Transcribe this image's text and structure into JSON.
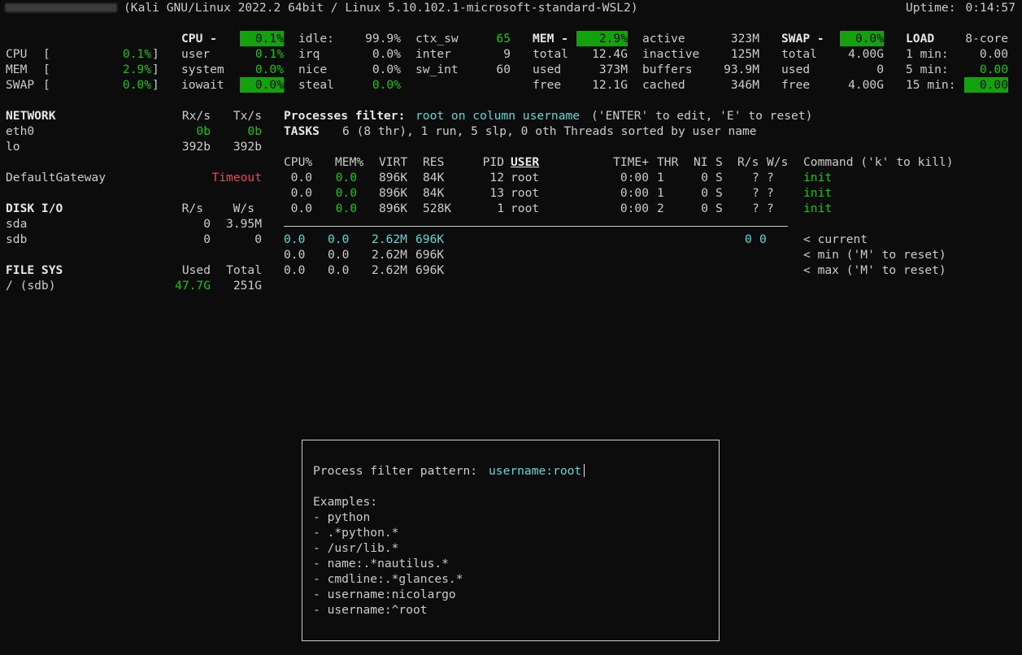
{
  "header": {
    "title": "(Kali GNU/Linux 2022.2 64bit / Linux 5.10.102.1-microsoft-standard-WSL2)",
    "uptime_label": "Uptime:",
    "uptime_value": "0:14:57"
  },
  "quicklook": {
    "cpu_label": "CPU",
    "cpu_value": "0.1%",
    "mem_label": "MEM",
    "mem_value": "2.9%",
    "swap_label": "SWAP",
    "swap_value": "0.0%",
    "open_bracket": "[",
    "close_bracket": "]"
  },
  "cpu": {
    "header": "CPU -",
    "total": "0.1%",
    "user_label": "user",
    "user": "0.1%",
    "system_label": "system",
    "system": "0.0%",
    "iowait_label": "iowait",
    "iowait": "0.0%",
    "idle_label": "idle:",
    "idle": "99.9%",
    "irq_label": "irq",
    "irq": "0.0%",
    "nice_label": "nice",
    "nice": "0.0%",
    "steal_label": "steal",
    "steal": "0.0%",
    "ctx_sw_label": "ctx_sw",
    "ctx_sw": "65",
    "inter_label": "inter",
    "inter": "9",
    "sw_int_label": "sw_int",
    "sw_int": "60"
  },
  "mem": {
    "header": "MEM -",
    "percent": "2.9%",
    "total_label": "total",
    "total": "12.4G",
    "used_label": "used",
    "used": "373M",
    "free_label": "free",
    "free": "12.1G",
    "active_label": "active",
    "active": "323M",
    "inactive_label": "inactive",
    "inactive": "125M",
    "buffers_label": "buffers",
    "buffers": "93.9M",
    "cached_label": "cached",
    "cached": "346M"
  },
  "swap": {
    "header": "SWAP -",
    "percent": "0.0%",
    "total_label": "total",
    "total": "4.00G",
    "used_label": "used",
    "used": "0",
    "free_label": "free",
    "free": "4.00G"
  },
  "load": {
    "header": "LOAD",
    "cores": "8-core",
    "m1_label": "1 min:",
    "m1": "0.00",
    "m5_label": "5 min:",
    "m5": "0.00",
    "m15_label": "15 min:",
    "m15": "0.00"
  },
  "network": {
    "header": "NETWORK",
    "rx_header": "Rx/s",
    "tx_header": "Tx/s",
    "rows": [
      {
        "name": "eth0",
        "rx": "0b",
        "tx": "0b"
      },
      {
        "name": "lo",
        "rx": "392b",
        "tx": "392b"
      }
    ]
  },
  "gateway": {
    "label": "DefaultGateway",
    "status": "Timeout"
  },
  "disk": {
    "header": "DISK I/O",
    "r_header": "R/s",
    "w_header": "W/s",
    "rows": [
      {
        "name": "sda",
        "r": "0",
        "w": "3.95M"
      },
      {
        "name": "sdb",
        "r": "0",
        "w": "0"
      }
    ]
  },
  "fs": {
    "header": "FILE SYS",
    "used_header": "Used",
    "total_header": "Total",
    "rows": [
      {
        "name": "/ (sdb)",
        "used": "47.7G",
        "total": "251G"
      }
    ]
  },
  "filter": {
    "label": "Processes filter:",
    "value": "root on column username",
    "hint": "('ENTER' to edit, 'E' to reset)"
  },
  "tasks": {
    "label": "TASKS",
    "summary": "6 (8 thr), 1 run, 5 slp, 0 oth Threads sorted by user name"
  },
  "proc_headers": {
    "cpu": "CPU%",
    "mem": "MEM%",
    "virt": "VIRT",
    "res": "RES",
    "pid": "PID",
    "user": "USER",
    "time": "TIME+",
    "thr": "THR",
    "ni": "NI",
    "s": "S",
    "rs": "R/s",
    "ws": "W/s",
    "cmd": "Command ('k' to kill)"
  },
  "processes": [
    {
      "cpu": "0.0",
      "mem": "0.0",
      "virt": "896K",
      "res": "84K",
      "pid": "12",
      "user": "root",
      "time": "0:00",
      "thr": "1",
      "ni": "0",
      "s": "S",
      "rs": "?",
      "ws": "?",
      "cmd": "init"
    },
    {
      "cpu": "0.0",
      "mem": "0.0",
      "virt": "896K",
      "res": "84K",
      "pid": "13",
      "user": "root",
      "time": "0:00",
      "thr": "1",
      "ni": "0",
      "s": "S",
      "rs": "?",
      "ws": "?",
      "cmd": "init"
    },
    {
      "cpu": "0.0",
      "mem": "0.0",
      "virt": "896K",
      "res": "528K",
      "pid": "1",
      "user": "root",
      "time": "0:00",
      "thr": "2",
      "ni": "0",
      "s": "S",
      "rs": "?",
      "ws": "?",
      "cmd": "init"
    }
  ],
  "summary": [
    {
      "cpu": "0.0",
      "mem": "0.0",
      "virt": "2.62M",
      "res": "696K",
      "rs": "0",
      "ws": "0",
      "label": "< current"
    },
    {
      "cpu": "0.0",
      "mem": "0.0",
      "virt": "2.62M",
      "res": "696K",
      "label": "< min ('M' to reset)"
    },
    {
      "cpu": "0.0",
      "mem": "0.0",
      "virt": "2.62M",
      "res": "696K",
      "label": "< max ('M' to reset)"
    }
  ],
  "dialog": {
    "prompt": "Process filter pattern:",
    "input_value": "username:root",
    "examples_title": "Examples:",
    "examples": [
      "- python",
      "- .*python.*",
      "- /usr/lib.*",
      "- name:.*nautilus.*",
      "- cmdline:.*glances.*",
      "- username:nicolargo",
      "- username:^root"
    ]
  },
  "colors": {
    "background": "#0c0c0c",
    "text": "#cccccc",
    "ok": "#16c60c",
    "highlight_bg": "#13a10e",
    "cyan": "#61d6d6",
    "critical": "#e74856"
  }
}
